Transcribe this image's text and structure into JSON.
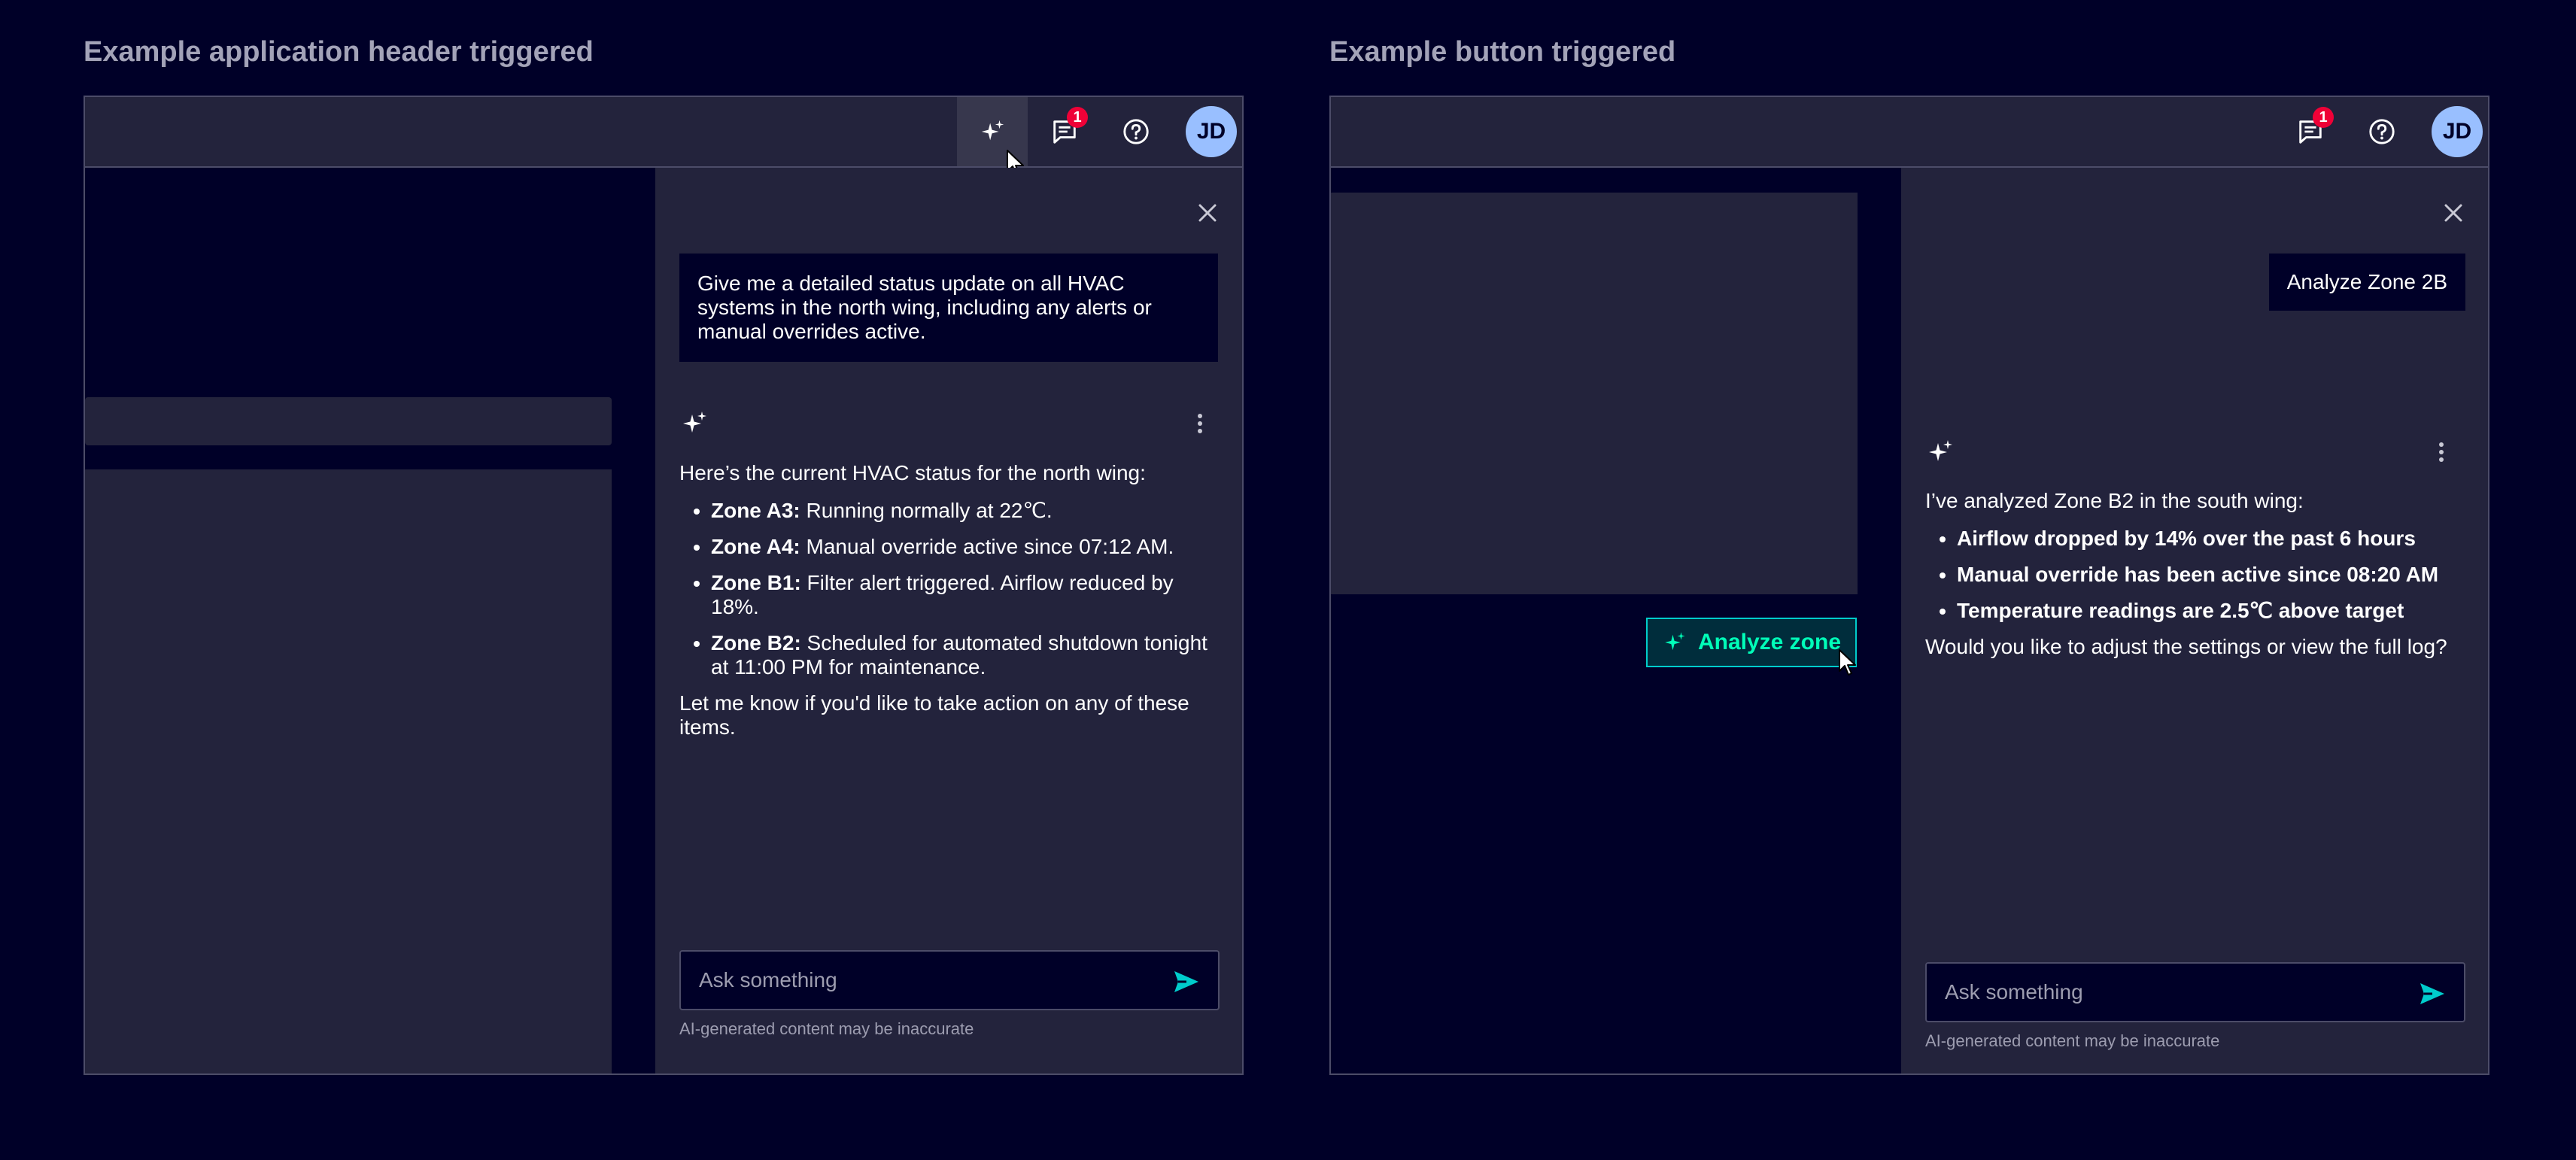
{
  "left_demo": {
    "title": "Example application header triggered",
    "header": {
      "notification_count": "1",
      "avatar_initials": "JD"
    },
    "chat": {
      "user_message": "Give me a detailed status update on all HVAC systems in the north wing, including any alerts or manual overrides active.",
      "intro": "Here’s the current HVAC status for the north wing:",
      "items": [
        {
          "label": "Zone A3:",
          "text": " Running normally at 22℃."
        },
        {
          "label": "Zone A4:",
          "text": " Manual override active since 07:12 AM."
        },
        {
          "label": "Zone B1:",
          "text": " Filter alert triggered. Airflow reduced by 18%."
        },
        {
          "label": "Zone B2:",
          "text": " Scheduled for automated shutdown tonight at 11:00 PM for maintenance."
        }
      ],
      "outro": "Let me know if you'd like to take action on any of these items.",
      "input_placeholder": "Ask something",
      "disclaimer": "AI-generated content may be inaccurate"
    }
  },
  "right_demo": {
    "title": "Example button triggered",
    "header": {
      "notification_count": "1",
      "avatar_initials": "JD"
    },
    "analyze_button_label": "Analyze zone",
    "chat": {
      "user_message": "Analyze Zone 2B",
      "intro": "I’ve analyzed Zone B2 in the south wing:",
      "items": [
        "Airflow dropped by 14% over the past 6 hours",
        "Manual override has been active since 08:20 AM",
        "Temperature readings are 2.5℃ above target"
      ],
      "outro": "Would you like to adjust the settings or view the full log?",
      "input_placeholder": "Ask something",
      "disclaimer": "AI-generated content may be inaccurate"
    }
  },
  "colors": {
    "background": "#000028",
    "surface": "#23233c",
    "accent": "#00cccc",
    "badge": "#ef0137",
    "avatar": "#99bfff"
  },
  "icons": [
    "sparkle-icon",
    "chat-icon",
    "help-icon",
    "close-icon",
    "kebab-icon",
    "send-icon",
    "cursor-icon"
  ]
}
